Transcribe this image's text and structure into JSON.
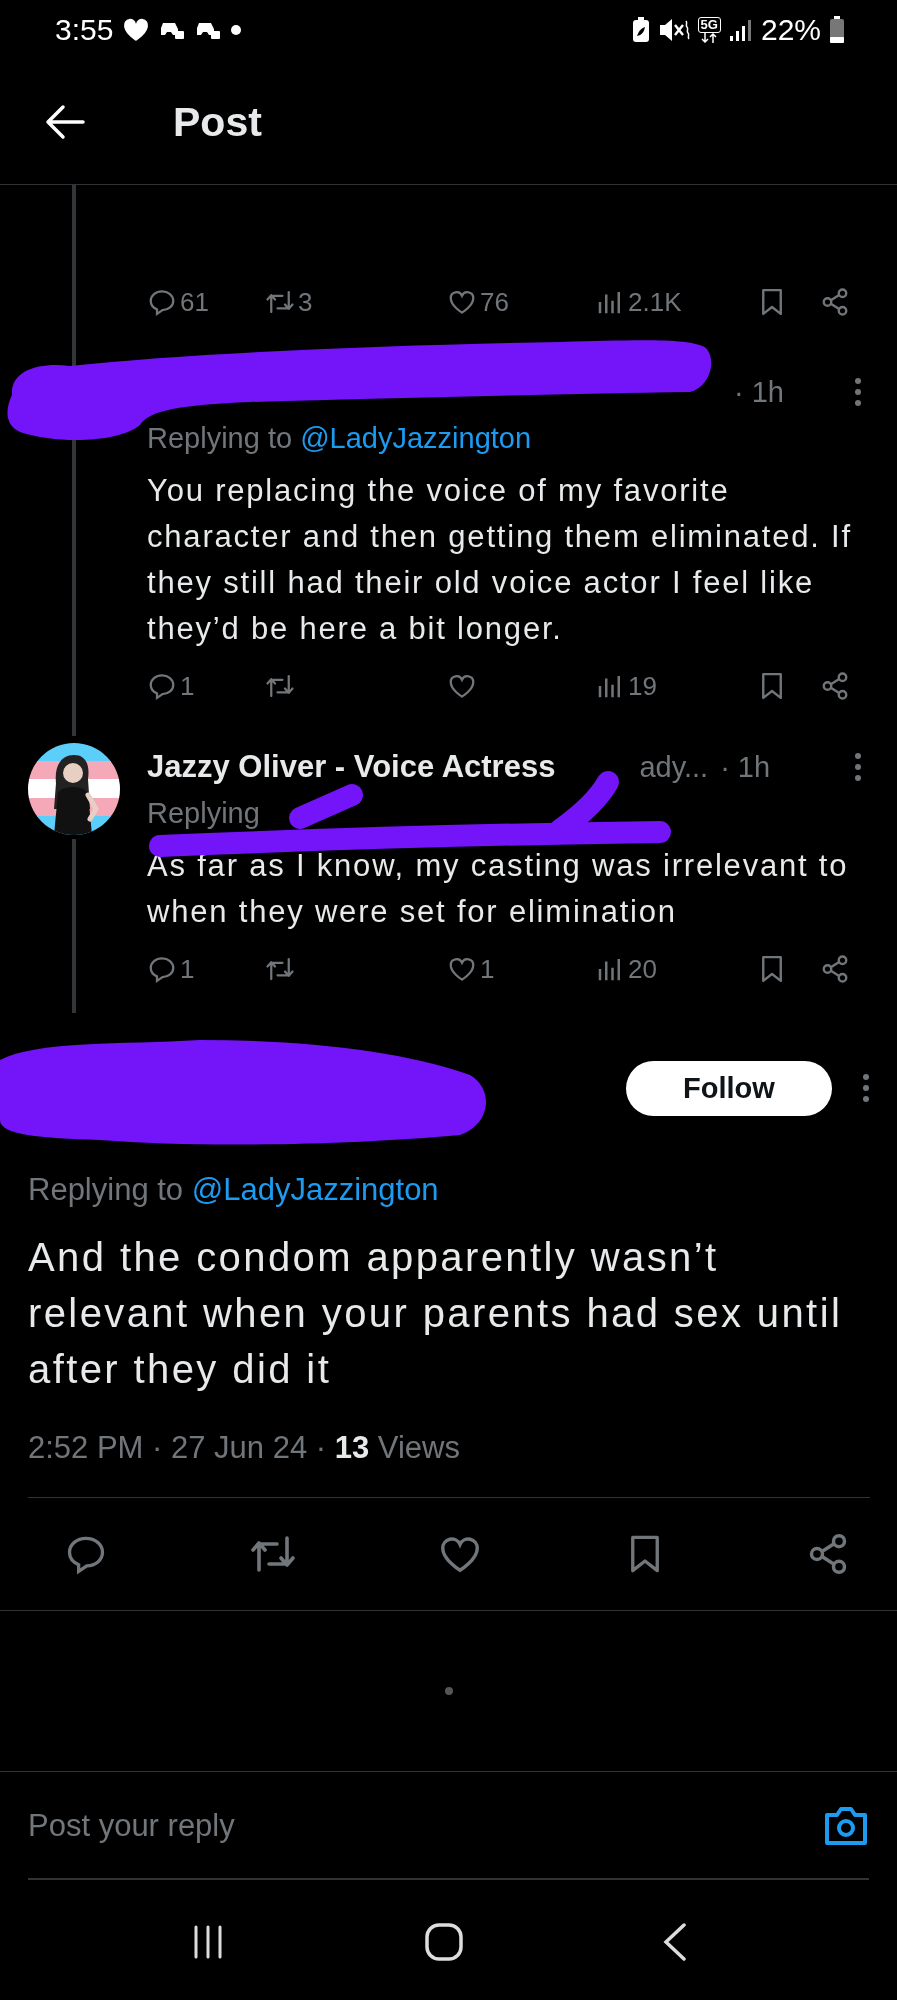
{
  "status_bar": {
    "time": "3:55",
    "network": "5G",
    "battery": "22%"
  },
  "header": {
    "title": "Post"
  },
  "thread": [
    {
      "kind": "stats-only",
      "stats": {
        "replies": "61",
        "reposts": "3",
        "likes": "76",
        "views": "2.1K"
      }
    },
    {
      "kind": "hidden-author",
      "time": "· 1h",
      "replying_label": "Replying to",
      "replying_handle": "@LadyJazzington",
      "body": "You replacing the voice of my favorite character and then getting them eliminated. If they still had their old voice actor I feel like they’d be here a bit longer.",
      "stats": {
        "replies": "1",
        "views": "19"
      }
    },
    {
      "kind": "author",
      "author": "Jazzy Oliver - Voice Actress",
      "handle": "ady...",
      "time": "· 1h",
      "replying_label": "Replying",
      "body": "As far as I know, my casting was irrelevant to when they were set for elimination",
      "stats": {
        "replies": "1",
        "likes": "1",
        "views": "20"
      }
    }
  ],
  "main_post": {
    "follow_button": "Follow",
    "replying_label": "Replying to",
    "replying_handle": "@LadyJazzington",
    "body": "And the condom apparently wasn’t relevant when your parents had sex until after they did it",
    "timestamp": "2:52 PM · 27 Jun 24 · **13** Views"
  },
  "reply_box": {
    "placeholder": "Post your reply"
  }
}
